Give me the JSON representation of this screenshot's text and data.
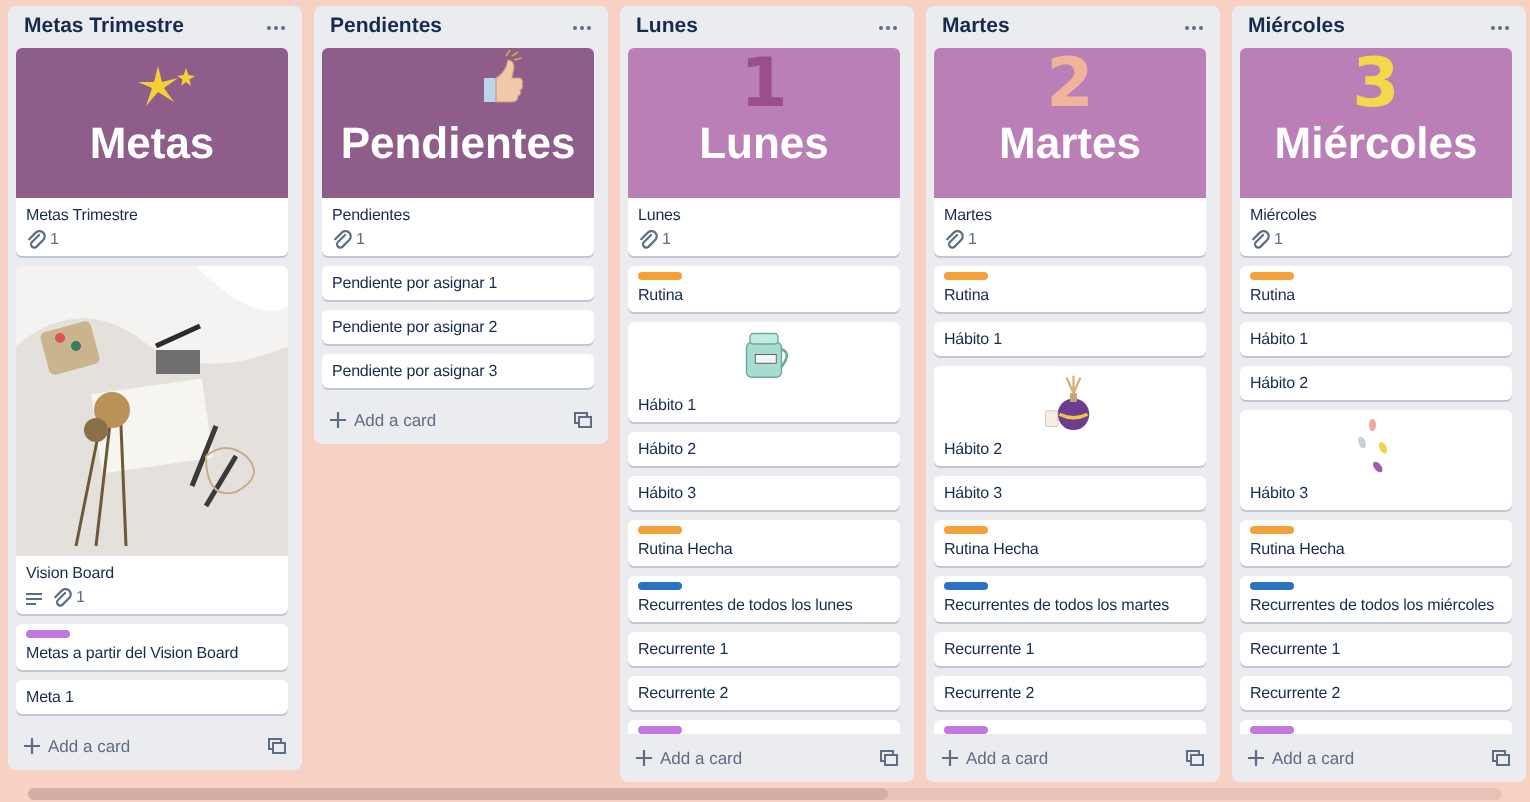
{
  "board": {
    "lists": [
      {
        "title": "Metas Trimestre",
        "add_card": "Add a card",
        "cards": [
          {
            "kind": "cover",
            "color": "#8e5d8a",
            "cover_text": "Metas",
            "art": {
              "kind": "stars"
            },
            "title": "Metas Trimestre",
            "attachments": "1"
          },
          {
            "title": "Vision Board",
            "has_description": true,
            "attachments": "1"
          },
          {
            "kind": "card",
            "color": "#c377e0",
            "title": "Metas a partir del Vision Board"
          },
          {
            "kind": "card",
            "title": "Meta 1"
          }
        ]
      },
      {
        "title": "Pendientes",
        "add_card": "Add a card",
        "cards": [
          {
            "kind": "cover",
            "color": "#8e5d8a",
            "cover_text": "Pendientes",
            "art": {
              "kind": "thumb"
            },
            "title": "Pendientes",
            "attachments": "1"
          },
          {
            "kind": "card",
            "title": "Pendiente por asignar 1"
          },
          {
            "kind": "card",
            "title": "Pendiente por asignar 2"
          },
          {
            "kind": "card",
            "title": "Pendiente por asignar 3"
          }
        ]
      },
      {
        "title": "Lunes",
        "add_card": "Add a card",
        "cards": [
          {
            "kind": "cover",
            "color": "#b97fb6",
            "cover_text": "Lunes",
            "art": {
              "kind": "numeral",
              "text": "1",
              "color": "#9a4f8a"
            },
            "title": "Lunes",
            "attachments": "1"
          },
          {
            "kind": "card",
            "color": "#f5a13a",
            "title": "Rutina"
          },
          {
            "kind": "sticker",
            "sticker": {
              "kind": "jar"
            },
            "title": "Hábito 1"
          },
          {
            "kind": "card",
            "title": "Hábito 2"
          },
          {
            "kind": "card",
            "title": "Hábito 3"
          },
          {
            "kind": "card",
            "color": "#f5a13a",
            "title": "Rutina Hecha"
          },
          {
            "kind": "card",
            "color": "#2a73c0",
            "title": "Recurrentes de todos los lunes"
          },
          {
            "kind": "card",
            "title": "Recurrente 1"
          },
          {
            "kind": "card",
            "title": "Recurrente 2"
          },
          {
            "kind": "card",
            "color": "#c377e0"
          }
        ]
      },
      {
        "title": "Martes",
        "add_card": "Add a card",
        "cards": [
          {
            "kind": "cover",
            "color": "#b97fb6",
            "cover_text": "Martes",
            "art": {
              "kind": "numeral",
              "text": "2",
              "color": "#f0b49c"
            },
            "title": "Martes",
            "attachments": "1"
          },
          {
            "kind": "card",
            "color": "#f5a13a",
            "title": "Rutina"
          },
          {
            "kind": "card",
            "title": "Hábito 1"
          },
          {
            "kind": "sticker",
            "sticker": {
              "kind": "potion"
            },
            "title": "Hábito 2"
          },
          {
            "kind": "card",
            "title": "Hábito 3"
          },
          {
            "kind": "card",
            "color": "#f5a13a",
            "title": "Rutina Hecha"
          },
          {
            "kind": "card",
            "color": "#2a73c0",
            "title": "Recurrentes de todos los martes"
          },
          {
            "kind": "card",
            "title": "Recurrente 1"
          },
          {
            "kind": "card",
            "title": "Recurrente 2"
          },
          {
            "kind": "card",
            "color": "#c377e0"
          }
        ]
      },
      {
        "title": "Miércoles",
        "add_card": "Add a card",
        "cards": [
          {
            "kind": "cover",
            "color": "#b97fb6",
            "cover_text": "Miércoles",
            "art": {
              "kind": "numeral",
              "text": "3",
              "color": "#f5d74a"
            },
            "title": "Miércoles",
            "attachments": "1"
          },
          {
            "kind": "card",
            "color": "#f5a13a",
            "title": "Rutina"
          },
          {
            "kind": "card",
            "title": "Hábito 1"
          },
          {
            "kind": "card",
            "title": "Hábito 2"
          },
          {
            "kind": "sticker",
            "sticker": {
              "kind": "pills"
            },
            "title": "Hábito 3"
          },
          {
            "kind": "card",
            "color": "#f5a13a",
            "title": "Rutina Hecha"
          },
          {
            "kind": "card",
            "color": "#2a73c0",
            "title": "Recurrentes de todos los miércoles"
          },
          {
            "kind": "card",
            "title": "Recurrente 1"
          },
          {
            "kind": "card",
            "title": "Recurrente 2"
          },
          {
            "kind": "card",
            "color": "#c377e0"
          }
        ]
      }
    ]
  }
}
